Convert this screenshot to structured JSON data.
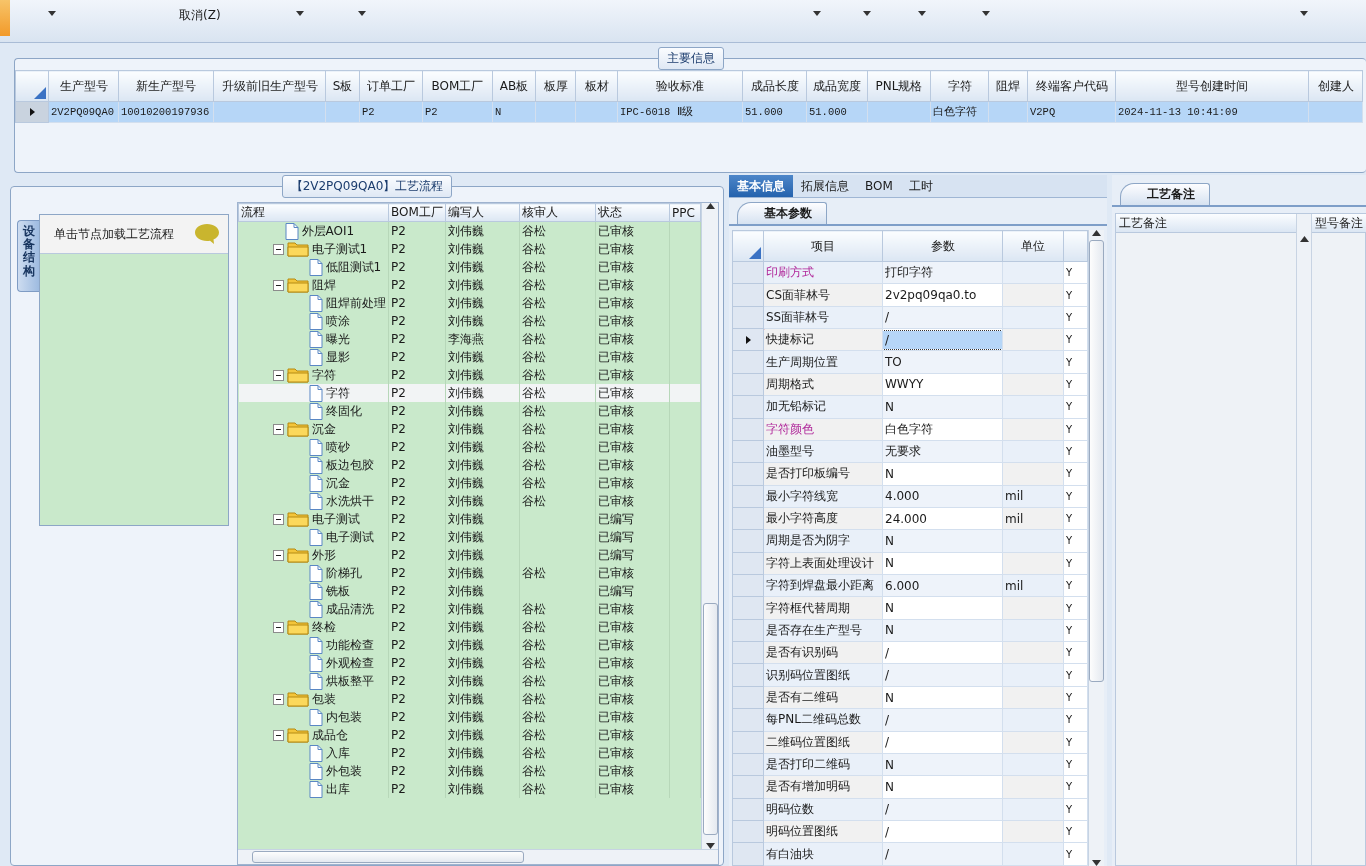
{
  "toolbar": {
    "menu_item": "取消(Z)"
  },
  "main_info": {
    "title": "主要信息",
    "columns": [
      "生产型号",
      "新生产型号",
      "升级前旧生产型号",
      "S板",
      "订单工厂",
      "BOM工厂",
      "AB板",
      "板厚",
      "板材",
      "验收标准",
      "成品长度",
      "成品宽度",
      "PNL规格",
      "字符",
      "阻焊",
      "终端客户代码",
      "型号创建时间",
      "创建人"
    ],
    "rows": [
      {
        "selected": true,
        "cells": [
          "2V2PQ09QA0",
          "10010200197936",
          "",
          "",
          "P2",
          "P2",
          "N",
          "",
          "",
          "IPC-6018 Ⅱ级",
          "51.000",
          "51.000",
          "",
          "白色字符",
          "",
          "V2PQ",
          "2024-11-13 10:41:09",
          ""
        ]
      }
    ]
  },
  "process": {
    "title": "【2V2PQ09QA0】工艺流程",
    "side_tab": "设备结构",
    "hint": "单击节点加载工艺流程",
    "columns": [
      "流程",
      "BOM工厂",
      "编写人",
      "核审人",
      "状态",
      "PPC"
    ],
    "tree": [
      {
        "kind": "leaf",
        "label": "外层AOI1",
        "selected": false,
        "cells": [
          "P2",
          "刘伟巍",
          "谷松",
          "已审核"
        ]
      },
      {
        "kind": "folder",
        "label": "电子测试1",
        "expanded": true,
        "selected": false,
        "cells": [
          "P2",
          "刘伟巍",
          "谷松",
          "已审核"
        ],
        "children": [
          {
            "kind": "leaf",
            "label": "低阻测试1",
            "selected": false,
            "cells": [
              "P2",
              "刘伟巍",
              "谷松",
              "已审核"
            ]
          }
        ]
      },
      {
        "kind": "folder",
        "label": "阻焊",
        "expanded": true,
        "selected": false,
        "cells": [
          "P2",
          "刘伟巍",
          "谷松",
          "已审核"
        ],
        "children": [
          {
            "kind": "leaf",
            "label": "阻焊前处理",
            "selected": false,
            "cells": [
              "P2",
              "刘伟巍",
              "谷松",
              "已审核"
            ]
          },
          {
            "kind": "leaf",
            "label": "喷涂",
            "selected": false,
            "cells": [
              "P2",
              "刘伟巍",
              "谷松",
              "已审核"
            ]
          },
          {
            "kind": "leaf",
            "label": "曝光",
            "selected": false,
            "cells": [
              "P2",
              "李海燕",
              "谷松",
              "已审核"
            ]
          },
          {
            "kind": "leaf",
            "label": "显影",
            "selected": false,
            "cells": [
              "P2",
              "刘伟巍",
              "谷松",
              "已审核"
            ]
          }
        ]
      },
      {
        "kind": "folder",
        "label": "字符",
        "expanded": true,
        "selected": false,
        "cells": [
          "P2",
          "刘伟巍",
          "谷松",
          "已审核"
        ],
        "children": [
          {
            "kind": "leaf",
            "label": "字符",
            "selected": true,
            "cells": [
              "P2",
              "刘伟巍",
              "谷松",
              "已审核"
            ]
          },
          {
            "kind": "leaf",
            "label": "终固化",
            "selected": false,
            "cells": [
              "P2",
              "刘伟巍",
              "谷松",
              "已审核"
            ]
          }
        ]
      },
      {
        "kind": "folder",
        "label": "沉金",
        "expanded": true,
        "selected": false,
        "cells": [
          "P2",
          "刘伟巍",
          "谷松",
          "已审核"
        ],
        "children": [
          {
            "kind": "leaf",
            "label": "喷砂",
            "selected": false,
            "cells": [
              "P2",
              "刘伟巍",
              "谷松",
              "已审核"
            ]
          },
          {
            "kind": "leaf",
            "label": "板边包胶",
            "selected": false,
            "cells": [
              "P2",
              "刘伟巍",
              "谷松",
              "已审核"
            ]
          },
          {
            "kind": "leaf",
            "label": "沉金",
            "selected": false,
            "cells": [
              "P2",
              "刘伟巍",
              "谷松",
              "已审核"
            ]
          },
          {
            "kind": "leaf",
            "label": "水洗烘干",
            "selected": false,
            "cells": [
              "P2",
              "刘伟巍",
              "谷松",
              "已审核"
            ]
          }
        ]
      },
      {
        "kind": "folder",
        "label": "电子测试",
        "expanded": true,
        "selected": false,
        "cells": [
          "P2",
          "刘伟巍",
          "",
          "已编写"
        ],
        "children": [
          {
            "kind": "leaf",
            "label": "电子测试",
            "selected": false,
            "cells": [
              "P2",
              "刘伟巍",
              "",
              "已编写"
            ]
          }
        ]
      },
      {
        "kind": "folder",
        "label": "外形",
        "expanded": true,
        "selected": false,
        "cells": [
          "P2",
          "刘伟巍",
          "",
          "已编写"
        ],
        "children": [
          {
            "kind": "leaf",
            "label": "阶梯孔",
            "selected": false,
            "cells": [
              "P2",
              "刘伟巍",
              "谷松",
              "已审核"
            ]
          },
          {
            "kind": "leaf",
            "label": "铣板",
            "selected": false,
            "cells": [
              "P2",
              "刘伟巍",
              "",
              "已编写"
            ]
          },
          {
            "kind": "leaf",
            "label": "成品清洗",
            "selected": false,
            "cells": [
              "P2",
              "刘伟巍",
              "谷松",
              "已审核"
            ]
          }
        ]
      },
      {
        "kind": "folder",
        "label": "终检",
        "expanded": true,
        "selected": false,
        "cells": [
          "P2",
          "刘伟巍",
          "谷松",
          "已审核"
        ],
        "children": [
          {
            "kind": "leaf",
            "label": "功能检查",
            "selected": false,
            "cells": [
              "P2",
              "刘伟巍",
              "谷松",
              "已审核"
            ]
          },
          {
            "kind": "leaf",
            "label": "外观检查",
            "selected": false,
            "cells": [
              "P2",
              "刘伟巍",
              "谷松",
              "已审核"
            ]
          },
          {
            "kind": "leaf",
            "label": "烘板整平",
            "selected": false,
            "cells": [
              "P2",
              "刘伟巍",
              "谷松",
              "已审核"
            ]
          }
        ]
      },
      {
        "kind": "folder",
        "label": "包装",
        "expanded": true,
        "selected": false,
        "cells": [
          "P2",
          "刘伟巍",
          "谷松",
          "已审核"
        ],
        "children": [
          {
            "kind": "leaf",
            "label": "内包装",
            "selected": false,
            "cells": [
              "P2",
              "刘伟巍",
              "谷松",
              "已审核"
            ]
          }
        ]
      },
      {
        "kind": "folder",
        "label": "成品仓",
        "expanded": true,
        "selected": false,
        "cells": [
          "P2",
          "刘伟巍",
          "谷松",
          "已审核"
        ],
        "children": [
          {
            "kind": "leaf",
            "label": "入库",
            "selected": false,
            "cells": [
              "P2",
              "刘伟巍",
              "谷松",
              "已审核"
            ]
          },
          {
            "kind": "leaf",
            "label": "外包装",
            "selected": false,
            "cells": [
              "P2",
              "刘伟巍",
              "谷松",
              "已审核"
            ]
          },
          {
            "kind": "leaf",
            "label": "出库",
            "selected": false,
            "cells": [
              "P2",
              "刘伟巍",
              "谷松",
              "已审核"
            ]
          }
        ]
      }
    ]
  },
  "detail": {
    "tabs": [
      {
        "label": "基本信息",
        "selected": true
      },
      {
        "label": "拓展信息",
        "selected": false
      },
      {
        "label": "BOM",
        "selected": false
      },
      {
        "label": "工时",
        "selected": false
      }
    ],
    "subtab": "基本参数",
    "columns": [
      "项目",
      "参数",
      "单位"
    ],
    "rows": [
      {
        "item": "印刷方式",
        "value": "打印字符",
        "unit": "",
        "flag": "Y",
        "highlight": true,
        "selected": false,
        "annotated": false
      },
      {
        "item": "CS面菲林号",
        "value": "2v2pq09qa0.to",
        "unit": "",
        "flag": "Y",
        "highlight": false,
        "selected": false,
        "annotated": false
      },
      {
        "item": "SS面菲林号",
        "value": "/",
        "unit": "",
        "flag": "Y",
        "highlight": false,
        "selected": false,
        "annotated": false
      },
      {
        "item": "快捷标记",
        "value": "/",
        "unit": "",
        "flag": "Y",
        "highlight": false,
        "selected": true,
        "annotated": true
      },
      {
        "item": "生产周期位置",
        "value": "TO",
        "unit": "",
        "flag": "Y",
        "highlight": false,
        "selected": false,
        "annotated": false
      },
      {
        "item": "周期格式",
        "value": "WWYY",
        "unit": "",
        "flag": "Y",
        "highlight": false,
        "selected": false,
        "annotated": false
      },
      {
        "item": "加无铅标记",
        "value": "N",
        "unit": "",
        "flag": "Y",
        "highlight": false,
        "selected": false,
        "annotated": false
      },
      {
        "item": "字符颜色",
        "value": "白色字符",
        "unit": "",
        "flag": "Y",
        "highlight": true,
        "selected": false,
        "annotated": false
      },
      {
        "item": "油墨型号",
        "value": "无要求",
        "unit": "",
        "flag": "Y",
        "highlight": false,
        "selected": false,
        "annotated": false
      },
      {
        "item": "是否打印板编号",
        "value": "N",
        "unit": "",
        "flag": "Y",
        "highlight": false,
        "selected": false,
        "annotated": false
      },
      {
        "item": "最小字符线宽",
        "value": "4.000",
        "unit": "mil",
        "flag": "Y",
        "highlight": false,
        "selected": false,
        "annotated": false
      },
      {
        "item": "最小字符高度",
        "value": "24.000",
        "unit": "mil",
        "flag": "Y",
        "highlight": false,
        "selected": false,
        "annotated": false
      },
      {
        "item": "周期是否为阴字",
        "value": "N",
        "unit": "",
        "flag": "Y",
        "highlight": false,
        "selected": false,
        "annotated": false
      },
      {
        "item": "字符上表面处理设计",
        "value": "N",
        "unit": "",
        "flag": "Y",
        "highlight": false,
        "selected": false,
        "annotated": false
      },
      {
        "item": "字符到焊盘最小距离",
        "value": "6.000",
        "unit": "mil",
        "flag": "Y",
        "highlight": false,
        "selected": false,
        "annotated": false
      },
      {
        "item": "字符框代替周期",
        "value": "N",
        "unit": "",
        "flag": "Y",
        "highlight": false,
        "selected": false,
        "annotated": false
      },
      {
        "item": "是否存在生产型号",
        "value": "N",
        "unit": "",
        "flag": "Y",
        "highlight": false,
        "selected": false,
        "annotated": false
      },
      {
        "item": "是否有识别码",
        "value": "/",
        "unit": "",
        "flag": "Y",
        "highlight": false,
        "selected": false,
        "annotated": false
      },
      {
        "item": "识别码位置图纸",
        "value": "/",
        "unit": "",
        "flag": "Y",
        "highlight": false,
        "selected": false,
        "annotated": false
      },
      {
        "item": "是否有二维码",
        "value": "N",
        "unit": "",
        "flag": "Y",
        "highlight": false,
        "selected": false,
        "annotated": false
      },
      {
        "item": "每PNL二维码总数",
        "value": "/",
        "unit": "",
        "flag": "Y",
        "highlight": false,
        "selected": false,
        "annotated": false
      },
      {
        "item": "二维码位置图纸",
        "value": "/",
        "unit": "",
        "flag": "Y",
        "highlight": false,
        "selected": false,
        "annotated": false
      },
      {
        "item": "是否打印二维码",
        "value": "N",
        "unit": "",
        "flag": "Y",
        "highlight": false,
        "selected": false,
        "annotated": false
      },
      {
        "item": "是否有增加明码",
        "value": "N",
        "unit": "",
        "flag": "Y",
        "highlight": false,
        "selected": false,
        "annotated": false
      },
      {
        "item": "明码位数",
        "value": "/",
        "unit": "",
        "flag": "Y",
        "highlight": false,
        "selected": false,
        "annotated": false
      },
      {
        "item": "明码位置图纸",
        "value": "/",
        "unit": "",
        "flag": "Y",
        "highlight": false,
        "selected": false,
        "annotated": false
      },
      {
        "item": "有白油块",
        "value": "/",
        "unit": "",
        "flag": "Y",
        "highlight": false,
        "selected": false,
        "annotated": false
      }
    ]
  },
  "notes": {
    "tab": "工艺备注",
    "columns": [
      "工艺备注",
      "型号备注"
    ]
  }
}
